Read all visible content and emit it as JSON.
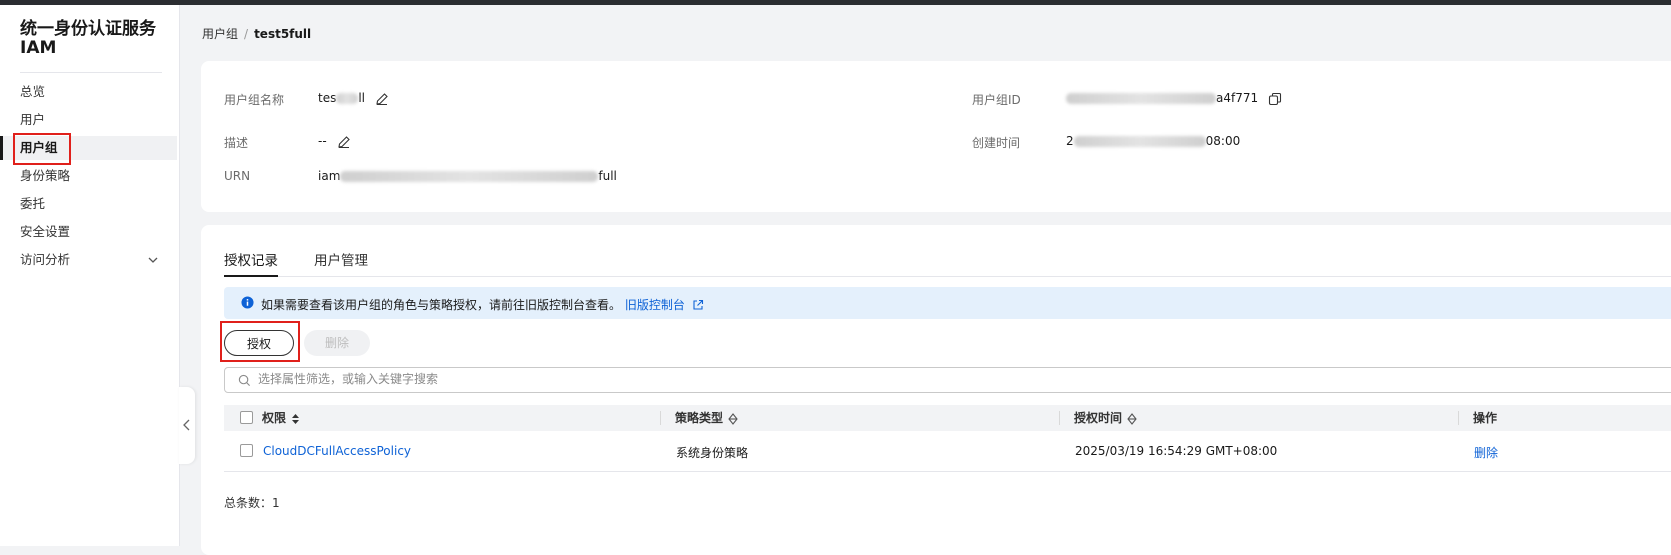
{
  "sidebar": {
    "title_line1": "统一身份认证服务",
    "title_line2": "IAM",
    "items": [
      {
        "label": "总览"
      },
      {
        "label": "用户"
      },
      {
        "label": "用户组"
      },
      {
        "label": "身份策略"
      },
      {
        "label": "委托"
      },
      {
        "label": "安全设置"
      },
      {
        "label": "访问分析"
      }
    ]
  },
  "breadcrumb": {
    "parent": "用户组",
    "separator": "/",
    "current": "test5full"
  },
  "info": {
    "name_label": "用户组名称",
    "name_value_prefix": "tes",
    "name_value_suffix": "ll",
    "desc_label": "描述",
    "desc_value": "--",
    "urn_label": "URN",
    "urn_value_prefix": "iam",
    "urn_value_suffix": "full",
    "id_label": "用户组ID",
    "id_value_suffix": "a4f771",
    "created_label": "创建时间",
    "created_value_prefix": "2",
    "created_value_suffix": "08:00"
  },
  "tabs": [
    {
      "label": "授权记录",
      "active": true
    },
    {
      "label": "用户管理",
      "active": false
    }
  ],
  "notice": {
    "text": "如果需要查看该用户组的角色与策略授权，请前往旧版控制台查看。",
    "link": "旧版控制台"
  },
  "toolbar": {
    "grant_label": "授权",
    "delete_label": "删除"
  },
  "search": {
    "placeholder": "选择属性筛选，或输入关键字搜索"
  },
  "table": {
    "columns": [
      "权限",
      "策略类型",
      "授权时间",
      "操作"
    ],
    "rows": [
      {
        "policy": "CloudDCFullAccessPolicy",
        "type": "系统身份策略",
        "time": "2025/03/19 16:54:29 GMT+08:00",
        "action": "删除"
      }
    ]
  },
  "footer": {
    "total": "总条数：1"
  },
  "colors": {
    "accent": "#0e62d6",
    "highlight": "#e0201b",
    "notice_bg": "#e4f0fc"
  }
}
